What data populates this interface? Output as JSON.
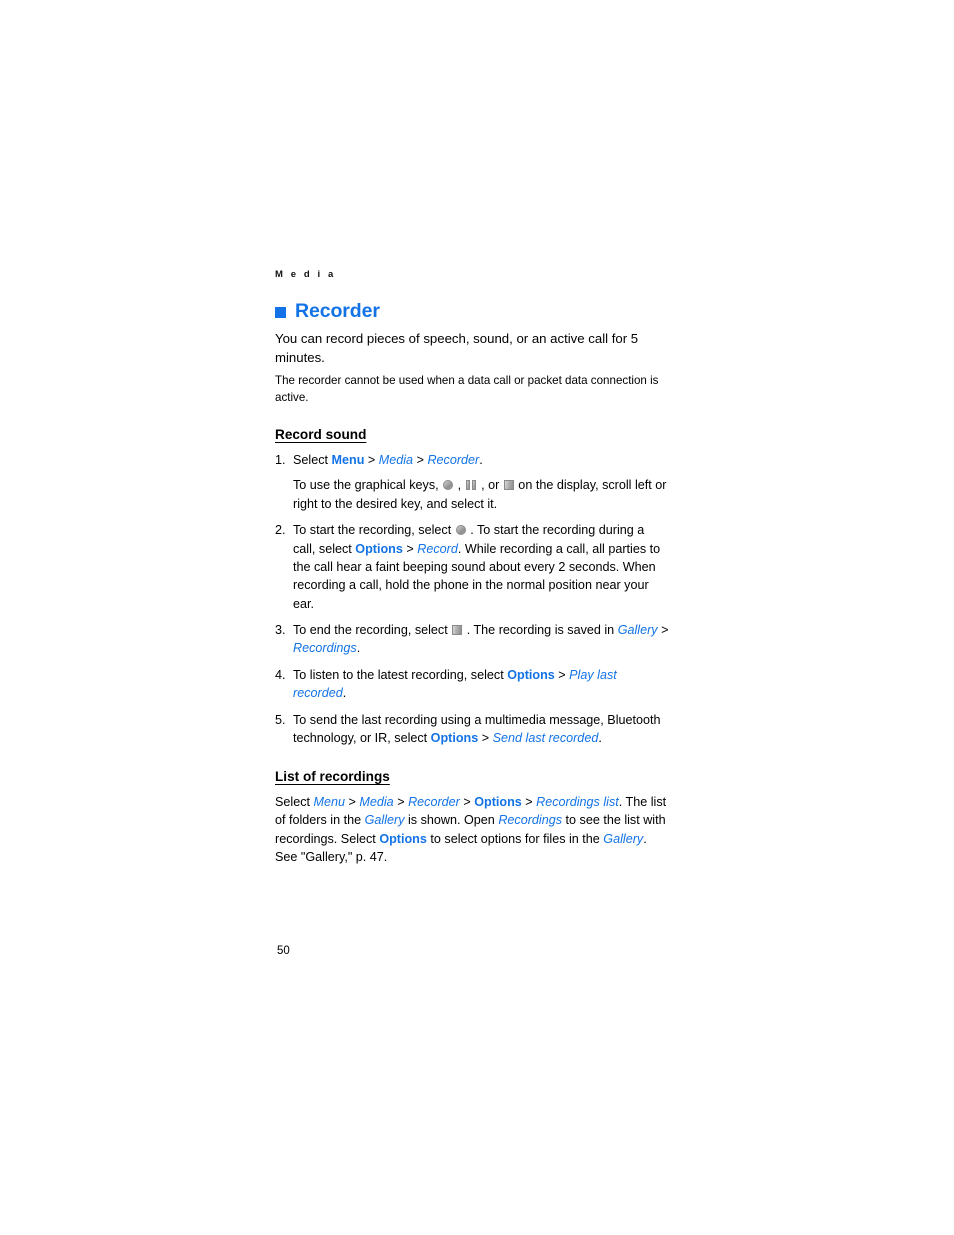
{
  "page": {
    "running_header": "M e d i a",
    "page_number": "50",
    "colors": {
      "link_blue": "#1373e6",
      "text_black": "#000000",
      "icon_grey": "#a5a5a5"
    }
  },
  "chapter": {
    "bullet_icon": "blue-square-bullet-icon",
    "title": "Recorder",
    "intro": "You can record pieces of speech, sound, or an active call for 5 minutes.",
    "note": "The recorder cannot be used when a data call or packet data connection is active."
  },
  "record_sound": {
    "heading": "Record sound",
    "steps": [
      {
        "num": "1.",
        "lead": "Select ",
        "nav": [
          {
            "text": "Menu",
            "style": "blue-bold"
          },
          {
            "text": " > ",
            "style": "sep"
          },
          {
            "text": "Media",
            "style": "blue-italic"
          },
          {
            "text": " > ",
            "style": "sep"
          },
          {
            "text": "Recorder",
            "style": "blue-italic"
          },
          {
            "text": ".",
            "style": "sep"
          }
        ],
        "substep_pre": "To use the graphical keys, ",
        "substep_icon1": "record-circle-icon",
        "substep_mid1": " , ",
        "substep_icon2": "pause-bars-icon",
        "substep_mid2": " , or ",
        "substep_icon3": "stop-square-icon",
        "substep_post": " on the display, scroll left or right to the desired key, and select it."
      },
      {
        "num": "2.",
        "part1": "To start the recording, select ",
        "icon": "record-circle-icon",
        "part2": " . To start the recording during a call, select ",
        "options_label": "Options",
        "sep": " > ",
        "record_label": "Record",
        "part3": ". While recording a call, all parties to the call hear a faint beeping sound about every 2 seconds. When recording a call, hold the phone in the normal position near your ear."
      },
      {
        "num": "3.",
        "part1": "To end the recording, select ",
        "icon": "stop-square-icon",
        "part2": " . The recording is saved in ",
        "gallery_label": "Gallery",
        "sep": " > ",
        "recordings_label": "Recordings",
        "part3": "."
      },
      {
        "num": "4.",
        "part1": "To listen to the latest recording, select ",
        "options_label": "Options",
        "sep": " > ",
        "action_label": "Play last recorded",
        "part2": "."
      },
      {
        "num": "5.",
        "part1": "To send the last recording using a multimedia message, Bluetooth technology, or IR, select ",
        "options_label": "Options",
        "sep": " > ",
        "action_label": "Send last recorded",
        "part2": "."
      }
    ]
  },
  "list_of_recordings": {
    "heading": "List of recordings",
    "p1_lead": "Select ",
    "nav": [
      {
        "text": "Menu",
        "style": "blue-italic"
      },
      {
        "text": " > ",
        "style": "sep"
      },
      {
        "text": "Media",
        "style": "blue-italic"
      },
      {
        "text": " > ",
        "style": "sep"
      },
      {
        "text": "Recorder",
        "style": "blue-italic"
      },
      {
        "text": " > ",
        "style": "sep"
      },
      {
        "text": "Options",
        "style": "blue-bold"
      },
      {
        "text": " > ",
        "style": "sep"
      },
      {
        "text": "Recordings list",
        "style": "blue-italic"
      }
    ],
    "p1_after": ". The list of folders in the ",
    "gallery_1": "Gallery",
    "p1_b": " is shown. Open ",
    "recordings_label": "Recordings",
    "p1_c": " to see the list with recordings. Select ",
    "options_label": "Options",
    "p1_d": " to select options for files in the ",
    "gallery_2": "Gallery",
    "p1_e": ".",
    "p2": "See \"Gallery,\" p. 47."
  }
}
